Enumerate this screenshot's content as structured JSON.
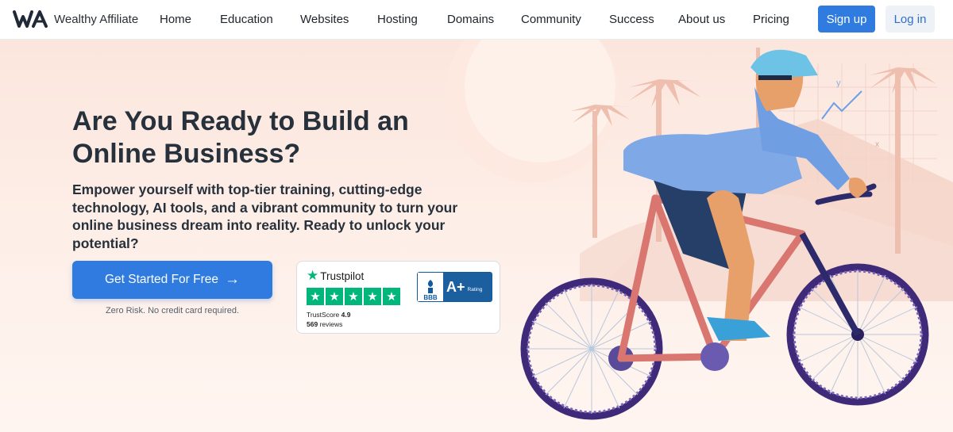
{
  "brand": {
    "name": "Wealthy Affiliate"
  },
  "nav": {
    "items": [
      {
        "label": "Home"
      },
      {
        "label": "Education"
      },
      {
        "label": "Websites"
      },
      {
        "label": "Hosting"
      },
      {
        "label": "Domains"
      },
      {
        "label": "Community"
      },
      {
        "label": "Success"
      },
      {
        "label": "About us"
      },
      {
        "label": "Pricing"
      }
    ],
    "signup_label": "Sign up",
    "login_label": "Log in"
  },
  "hero": {
    "headline": "Are You Ready to Build an Online Business?",
    "subhead": "Empower yourself with top-tier training, cutting-edge technology, AI tools, and a vibrant community to turn your online business dream into reality. Ready to unlock your potential?",
    "cta_label": "Get Started For Free",
    "cta_note": "Zero Risk. No credit card required."
  },
  "trust": {
    "trustpilot_label": "Trustpilot",
    "score_label": "TrustScore",
    "score": "4.9",
    "reviews_count": "569",
    "reviews_label": "reviews",
    "stars": 5,
    "bbb_text": "BBB",
    "bbb_grade": "A+",
    "bbb_rating_label": "Rating"
  },
  "colors": {
    "accent": "#2f7bdf",
    "trustpilot_green": "#00b67a",
    "bbb_blue": "#1c5f9f",
    "hero_bg": "#fbe6dd"
  },
  "icons": [
    "logo-icon",
    "arrow-right-icon",
    "trustpilot-star-icon",
    "bbb-torch-icon"
  ]
}
